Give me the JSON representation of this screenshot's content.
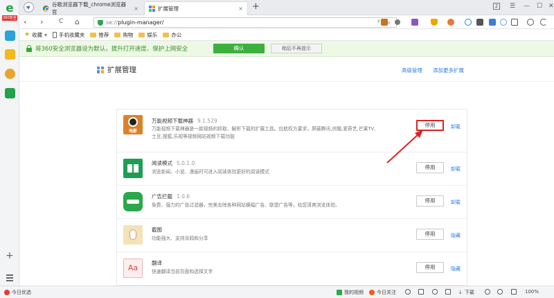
{
  "rail": {
    "logo_tag": "360安全"
  },
  "tabs": [
    {
      "label": "谷歌浏览器下载_chrome浏览器官",
      "close": "×"
    },
    {
      "label": "扩展管理",
      "close": "×"
    }
  ],
  "new_tab": "+",
  "window_controls": {
    "badge": "2",
    "menu": "☰",
    "minimize": "—",
    "maximize": "☐",
    "close": "✕"
  },
  "address": {
    "scheme": "se://",
    "path": "plugin-manager/",
    "bolt": "⚡",
    "caret": "⌄"
  },
  "nav": {
    "back": "‹",
    "forward": "›",
    "reload": "C",
    "home": "⌂"
  },
  "bookmarks": [
    {
      "label": "收藏",
      "type": "star"
    },
    {
      "label": "手机收藏夹",
      "type": "phone"
    },
    {
      "label": "推荐",
      "type": "folder"
    },
    {
      "label": "购物",
      "type": "folder"
    },
    {
      "label": "娱乐",
      "type": "folder"
    },
    {
      "label": "办公",
      "type": "folder"
    }
  ],
  "notification": {
    "text": "将360安全浏览器设为默认，提升打开速度、保护上网安全",
    "ok_label": "确认",
    "no_more_label": "稍后不再提示"
  },
  "page": {
    "title": "扩展管理",
    "link_advanced": "高级管理",
    "link_add_more": "添加更多扩展"
  },
  "extensions": [
    {
      "name": "万能视频下载神器",
      "version": "9.1.529",
      "desc": "万能视频下载神器是一款视频的抓取、解析下载的扩展工具。应航权方要求，屏蔽腾讯,优酷,爱奇艺,芒果TV,土豆,搜狐,乐视等视频网站视频下载功能",
      "icon_text": "电影",
      "disable_label": "停用",
      "remove_label": "卸载",
      "highlight": true
    },
    {
      "name": "阅读模式",
      "version": "5.0.1.0",
      "desc": "浏览新闻、小说、漫画时可进入阅读体验更好的阅读模式",
      "icon_text": "",
      "disable_label": "停用",
      "remove_label": "卸载",
      "highlight": false
    },
    {
      "name": "广告拦截",
      "version": "1.0.6",
      "desc": "免费、强力的广告过滤器，完美去除各种网站横幅广告、联盟广告等，给您清爽浏览体验。",
      "icon_text": "",
      "disable_label": "停用",
      "remove_label": "卸载",
      "highlight": false
    },
    {
      "name": "截图",
      "version": "",
      "desc": "功能强大、支持涂鸦和分享",
      "icon_text": "",
      "disable_label": "停用",
      "remove_label": "隐藏",
      "highlight": false
    },
    {
      "name": "翻译",
      "version": "",
      "desc": "快速翻译当前页面和选择文字",
      "icon_text": "Aa",
      "disable_label": "停用",
      "remove_label": "隐藏",
      "highlight": false
    }
  ],
  "statusbar": {
    "left": "今日优选",
    "video": "我的视频",
    "hot": "今日关注",
    "download": "下载",
    "zoom": "100%"
  },
  "colors": {
    "highlight_red": "#d92323",
    "link_blue": "#2d7be0",
    "notif_green": "#3cb03c"
  }
}
